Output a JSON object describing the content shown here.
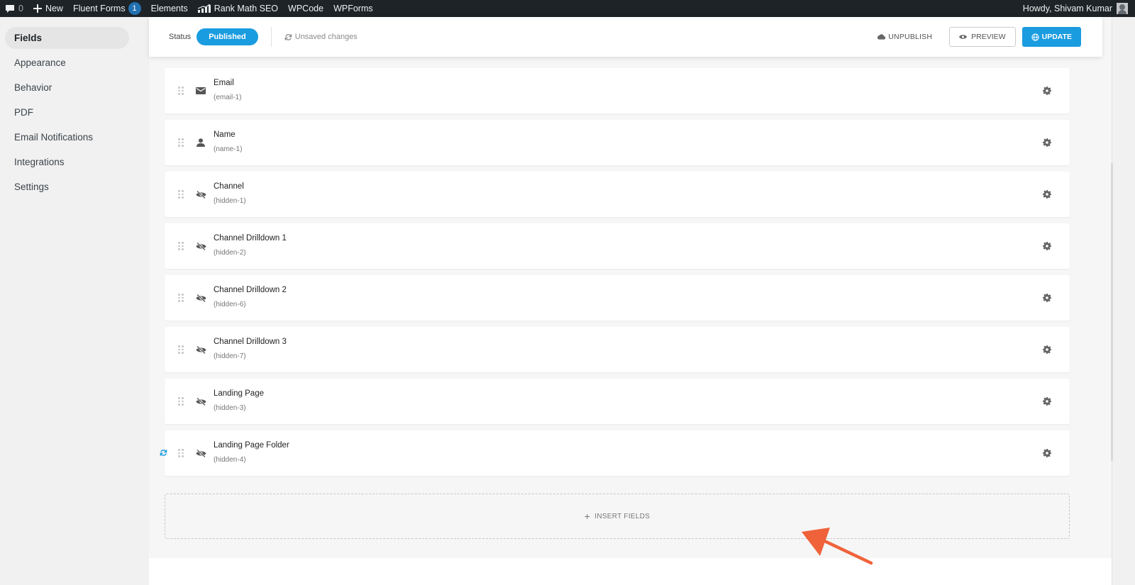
{
  "adminbar": {
    "comments_count": "0",
    "new_label": "New",
    "fluent_forms_label": "Fluent Forms",
    "fluent_forms_badge": "1",
    "elements_label": "Elements",
    "rank_math_label": "Rank Math SEO",
    "wpcode_label": "WPCode",
    "wpforms_label": "WPForms",
    "greeting": "Howdy, Shivam Kumar"
  },
  "nav": {
    "items": [
      {
        "label": "Fields",
        "active": true
      },
      {
        "label": "Appearance",
        "active": false
      },
      {
        "label": "Behavior",
        "active": false
      },
      {
        "label": "PDF",
        "active": false
      },
      {
        "label": "Email Notifications",
        "active": false
      },
      {
        "label": "Integrations",
        "active": false
      },
      {
        "label": "Settings",
        "active": false
      }
    ]
  },
  "topbar": {
    "status_label": "Status",
    "status_value": "Published",
    "unsaved_text": "Unsaved changes",
    "unpublish_label": "UNPUBLISH",
    "preview_label": "PREVIEW",
    "update_label": "UPDATE"
  },
  "fields": [
    {
      "label": "Email",
      "key": "(email-1)",
      "icon": "envelope-icon"
    },
    {
      "label": "Name",
      "key": "(name-1)",
      "icon": "user-icon"
    },
    {
      "label": "Channel",
      "key": "(hidden-1)",
      "icon": "eye-slash-icon"
    },
    {
      "label": "Channel Drilldown 1",
      "key": "(hidden-2)",
      "icon": "eye-slash-icon"
    },
    {
      "label": "Channel Drilldown 2",
      "key": "(hidden-6)",
      "icon": "eye-slash-icon"
    },
    {
      "label": "Channel Drilldown 3",
      "key": "(hidden-7)",
      "icon": "eye-slash-icon"
    },
    {
      "label": "Landing Page",
      "key": "(hidden-3)",
      "icon": "eye-slash-icon"
    },
    {
      "label": "Landing Page Folder",
      "key": "(hidden-4)",
      "icon": "eye-slash-icon"
    }
  ],
  "insert": {
    "plus": "+",
    "label": "INSERT FIELDS"
  },
  "colors": {
    "accent": "#1a9ce0",
    "adminbar": "#1d2327",
    "arrow": "#f0623a"
  }
}
